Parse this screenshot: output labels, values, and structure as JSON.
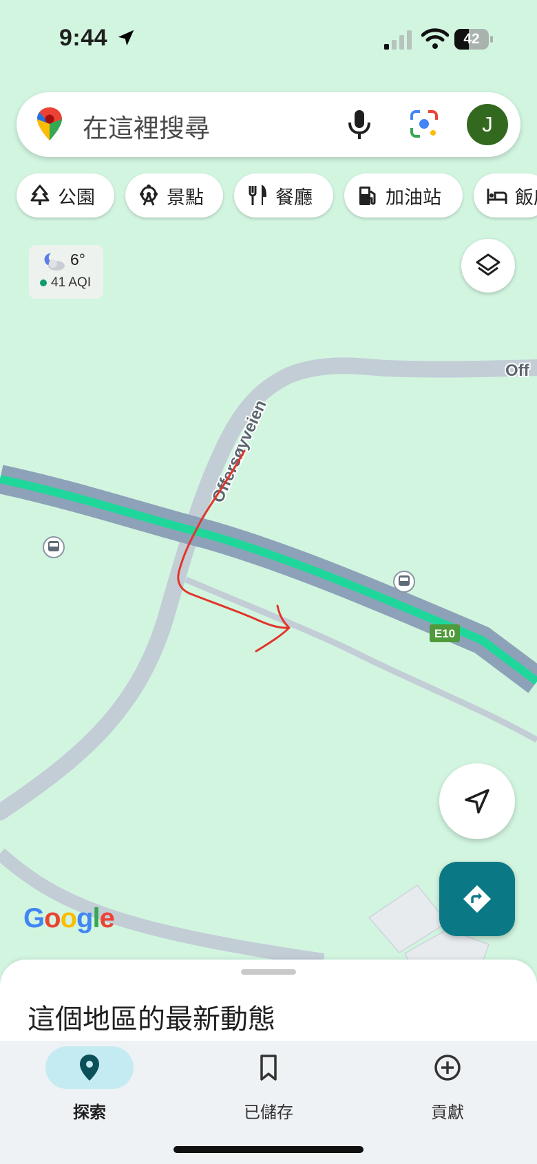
{
  "status_bar": {
    "time": "9:44",
    "battery": "42",
    "icons": [
      "location-arrow-icon",
      "signal-icon",
      "wifi-icon",
      "battery-icon"
    ]
  },
  "search": {
    "placeholder": "在這裡搜尋",
    "avatar_letter": "J",
    "icons": [
      "maps-pin-icon",
      "mic-icon",
      "lens-icon"
    ]
  },
  "chips": [
    {
      "label": "公園",
      "icon": "tree-icon"
    },
    {
      "label": "景點",
      "icon": "ferris-wheel-icon"
    },
    {
      "label": "餐廳",
      "icon": "fork-knife-icon"
    },
    {
      "label": "加油站",
      "icon": "gas-pump-icon"
    },
    {
      "label": "飯店",
      "icon": "bed-icon"
    }
  ],
  "weather": {
    "temp": "6°",
    "aqi": "41 AQI",
    "icon": "partly-cloudy-night-icon"
  },
  "map": {
    "road_label_1": "Offersøyveien",
    "road_label_2": "Off",
    "highway_shield": "E10",
    "logo": "Google",
    "colors": {
      "land": "#d2f5e0",
      "highway": "#1fd79a",
      "highway_edge": "#8da2b8",
      "road": "#c3cdd6",
      "annotation": "#e0362b"
    }
  },
  "sheet": {
    "title": "這個地區的最新動態"
  },
  "bottom_nav": [
    {
      "label": "探索",
      "icon": "explore-pin-icon",
      "active": true
    },
    {
      "label": "已儲存",
      "icon": "bookmark-icon",
      "active": false
    },
    {
      "label": "貢獻",
      "icon": "add-circle-icon",
      "active": false
    }
  ]
}
